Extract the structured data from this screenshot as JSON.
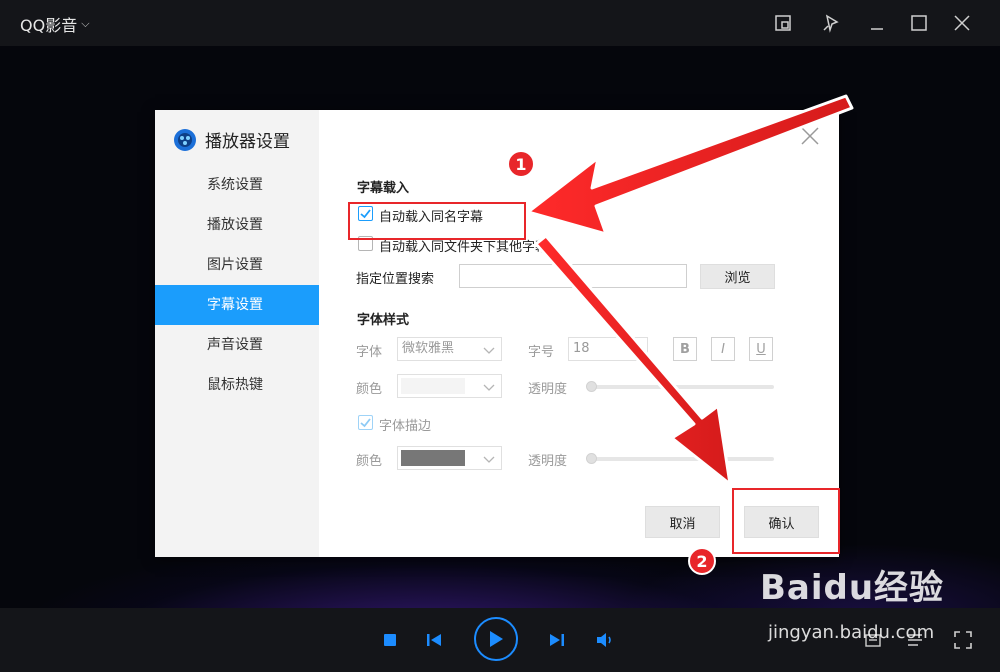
{
  "app": {
    "title": "QQ影音"
  },
  "dialog": {
    "title": "播放器设置",
    "nav": [
      {
        "label": "系统设置",
        "active": false
      },
      {
        "label": "播放设置",
        "active": false
      },
      {
        "label": "图片设置",
        "active": false
      },
      {
        "label": "字幕设置",
        "active": true
      },
      {
        "label": "声音设置",
        "active": false
      },
      {
        "label": "鼠标热键",
        "active": false
      }
    ],
    "subtitle_load": {
      "section_title": "字幕载入",
      "auto_same_name": {
        "label": "自动载入同名字幕",
        "checked": true
      },
      "auto_folder": {
        "label": "自动载入同文件夹下其他字幕",
        "checked": false
      },
      "search_label": "指定位置搜索",
      "search_value": "",
      "browse_label": "浏览"
    },
    "font_style": {
      "section_title": "字体样式",
      "font_label": "字体",
      "font_value": "微软雅黑",
      "size_label": "字号",
      "size_value": "18",
      "bold_label": "B",
      "italic_label": "I",
      "underline_label": "U",
      "color_label": "颜色",
      "color_value": "#f4f4f4",
      "opacity_label": "透明度",
      "outline": {
        "label": "字体描边",
        "checked": true
      },
      "outline_color_label": "颜色",
      "outline_color_value": "#777777",
      "outline_opacity_label": "透明度"
    },
    "cancel_label": "取消",
    "ok_label": "确认"
  },
  "annotations": {
    "step1": "1",
    "step2": "2"
  },
  "watermark": {
    "logo": "Baidu经验",
    "url": "jingyan.baidu.com"
  },
  "colors": {
    "accent": "#1b9dfc",
    "annotation_red": "#e8262a",
    "titlebar": "#141519"
  }
}
